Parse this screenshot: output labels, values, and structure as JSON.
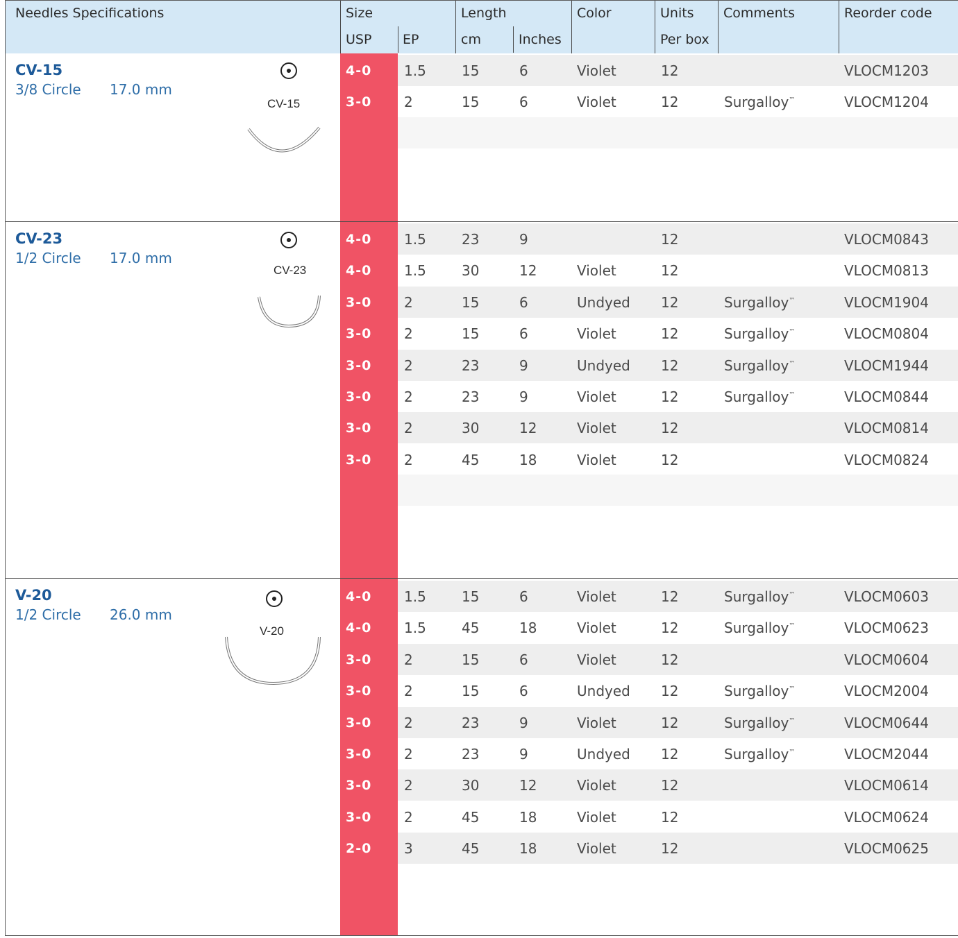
{
  "header": {
    "needles_specifications": "Needles Specifications",
    "size": "Size",
    "usp": "USP",
    "ep": "EP",
    "length": "Length",
    "cm": "cm",
    "inches": "Inches",
    "color": "Color",
    "units": "Units",
    "per_box": "Per box",
    "comments": "Comments",
    "reorder_code": "Reorder code"
  },
  "colors": {
    "header_bg": "#d4e8f6",
    "usp_bg": "#f05365",
    "needle_title": "#1d5a99",
    "needle_text": "#2f6ea8"
  },
  "trademark": "™",
  "groups": [
    {
      "name": "CV-15",
      "curve": "3/8 Circle",
      "length": "17.0 mm",
      "needle_label": "CV-15",
      "icon": "taper-point-circle-icon",
      "rows": [
        {
          "usp": "4-0",
          "ep": "1.5",
          "cm": "15",
          "inches": "6",
          "color": "Violet",
          "units": "12",
          "comment": "",
          "code": "VLOCM1203"
        },
        {
          "usp": "3-0",
          "ep": "2",
          "cm": "15",
          "inches": "6",
          "color": "Violet",
          "units": "12",
          "comment": "Surgalloy",
          "code": "VLOCM1204"
        }
      ]
    },
    {
      "name": "CV-23",
      "curve": "1/2 Circle",
      "length": "17.0 mm",
      "needle_label": "CV-23",
      "icon": "taper-point-circle-icon",
      "rows": [
        {
          "usp": "4-0",
          "ep": "1.5",
          "cm": "23",
          "inches": "9",
          "color": "",
          "units": "12",
          "comment": "",
          "code": "VLOCM0843"
        },
        {
          "usp": "4-0",
          "ep": "1.5",
          "cm": "30",
          "inches": "12",
          "color": "Violet",
          "units": "12",
          "comment": "",
          "code": "VLOCM0813"
        },
        {
          "usp": "3-0",
          "ep": "2",
          "cm": "15",
          "inches": "6",
          "color": "Undyed",
          "units": "12",
          "comment": "Surgalloy",
          "code": "VLOCM1904"
        },
        {
          "usp": "3-0",
          "ep": "2",
          "cm": "15",
          "inches": "6",
          "color": "Violet",
          "units": "12",
          "comment": "Surgalloy",
          "code": "VLOCM0804"
        },
        {
          "usp": "3-0",
          "ep": "2",
          "cm": "23",
          "inches": "9",
          "color": "Undyed",
          "units": "12",
          "comment": "Surgalloy",
          "code": "VLOCM1944"
        },
        {
          "usp": "3-0",
          "ep": "2",
          "cm": "23",
          "inches": "9",
          "color": "Violet",
          "units": "12",
          "comment": "Surgalloy",
          "code": "VLOCM0844"
        },
        {
          "usp": "3-0",
          "ep": "2",
          "cm": "30",
          "inches": "12",
          "color": "Violet",
          "units": "12",
          "comment": "",
          "code": "VLOCM0814"
        },
        {
          "usp": "3-0",
          "ep": "2",
          "cm": "45",
          "inches": "18",
          "color": "Violet",
          "units": "12",
          "comment": "",
          "code": "VLOCM0824"
        }
      ]
    },
    {
      "name": "V-20",
      "curve": "1/2 Circle",
      "length": "26.0 mm",
      "needle_label": "V-20",
      "icon": "taper-point-circle-icon",
      "rows": [
        {
          "usp": "4-0",
          "ep": "1.5",
          "cm": "15",
          "inches": "6",
          "color": "Violet",
          "units": "12",
          "comment": "Surgalloy",
          "code": "VLOCM0603"
        },
        {
          "usp": "4-0",
          "ep": "1.5",
          "cm": "45",
          "inches": "18",
          "color": "Violet",
          "units": "12",
          "comment": "Surgalloy",
          "code": "VLOCM0623"
        },
        {
          "usp": "3-0",
          "ep": "2",
          "cm": "15",
          "inches": "6",
          "color": "Violet",
          "units": "12",
          "comment": "",
          "code": "VLOCM0604"
        },
        {
          "usp": "3-0",
          "ep": "2",
          "cm": "15",
          "inches": "6",
          "color": "Undyed",
          "units": "12",
          "comment": "Surgalloy",
          "code": "VLOCM2004"
        },
        {
          "usp": "3-0",
          "ep": "2",
          "cm": "23",
          "inches": "9",
          "color": "Violet",
          "units": "12",
          "comment": "Surgalloy",
          "code": "VLOCM0644"
        },
        {
          "usp": "3-0",
          "ep": "2",
          "cm": "23",
          "inches": "9",
          "color": "Undyed",
          "units": "12",
          "comment": "Surgalloy",
          "code": "VLOCM2044"
        },
        {
          "usp": "3-0",
          "ep": "2",
          "cm": "30",
          "inches": "12",
          "color": "Violet",
          "units": "12",
          "comment": "",
          "code": "VLOCM0614"
        },
        {
          "usp": "3-0",
          "ep": "2",
          "cm": "45",
          "inches": "18",
          "color": "Violet",
          "units": "12",
          "comment": "",
          "code": "VLOCM0624"
        },
        {
          "usp": "2-0",
          "ep": "3",
          "cm": "45",
          "inches": "18",
          "color": "Violet",
          "units": "12",
          "comment": "",
          "code": "VLOCM0625"
        }
      ]
    }
  ]
}
